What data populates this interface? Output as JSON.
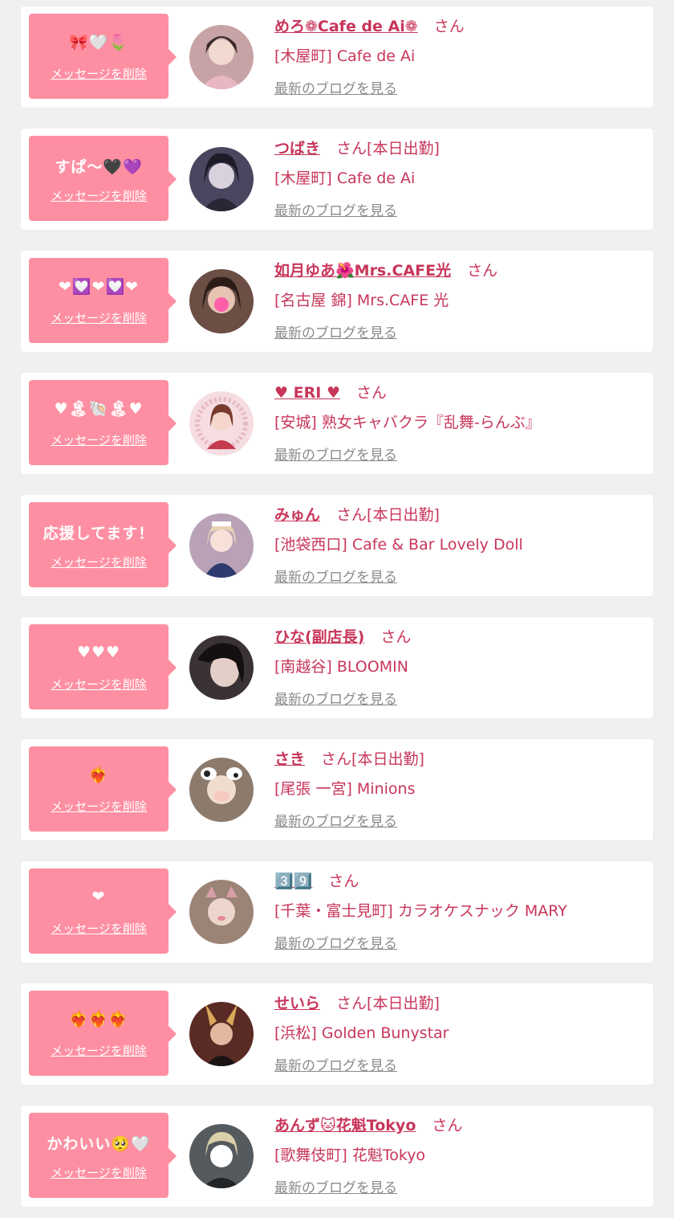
{
  "delete_label": "メッセージを削除",
  "blog_label": "最新のブログを見る",
  "san_label": "さん",
  "colors": {
    "bubble": "#fe8fa2",
    "name": "#c8365a",
    "link_gray": "#8a8a8a",
    "background": "#f0f0f0"
  },
  "items": [
    {
      "message": "🎀🤍🌷",
      "name": "めろ❁Cafe de Ai❁",
      "status": "",
      "shop": "[木屋町] Cafe de Ai",
      "avatar_color": "#c7a3a6"
    },
    {
      "message": "すぱ〜🖤💜",
      "name": "つばき",
      "status": "[本日出勤]",
      "shop": "[木屋町] Cafe de Ai",
      "avatar_color": "#4a4660"
    },
    {
      "message": "❤💟❤💟❤",
      "name": "如月ゆあ🌺Mrs.CAFE光",
      "status": "",
      "shop": "[名古屋 錦] Mrs.CAFE 光",
      "avatar_color": "#6b4e44"
    },
    {
      "message": "♥🏝🐚🏝♥",
      "name": "♥ ERI ♥",
      "status": "",
      "shop": "[安城] 熟女キャバクラ『乱舞-らんぶ』",
      "avatar_color": "#e9b9c2"
    },
    {
      "message": "応援してます！",
      "name": "みゅん",
      "status": "[本日出勤]",
      "shop": "[池袋西口] Cafe & Bar Lovely Doll",
      "avatar_color": "#b9a2b8"
    },
    {
      "message": "♥♥♥",
      "name": "ひな(副店長)",
      "status": "",
      "shop": "[南越谷] BLOOMIN",
      "avatar_color": "#3a3234"
    },
    {
      "message": "❤‍🔥",
      "name": "さき",
      "status": "[本日出勤]",
      "shop": "[尾張 一宮] Minions",
      "avatar_color": "#8c7a6c"
    },
    {
      "message": "❤",
      "name": "3️⃣9️⃣",
      "status": "",
      "shop": "[千葉・富士見町] カラオケスナック MARY",
      "avatar_color": "#9b8376"
    },
    {
      "message": "❤‍🔥❤‍🔥❤‍🔥",
      "name": "せいら",
      "status": "[本日出勤]",
      "shop": "[浜松] Golden Bunystar",
      "avatar_color": "#5a2a24"
    },
    {
      "message": "かわいい🥺🤍",
      "name": "あんず🐱花魁Tokyo",
      "status": "",
      "shop": "[歌舞伎町] 花魁Tokyo",
      "avatar_color": "#555a5e"
    }
  ]
}
